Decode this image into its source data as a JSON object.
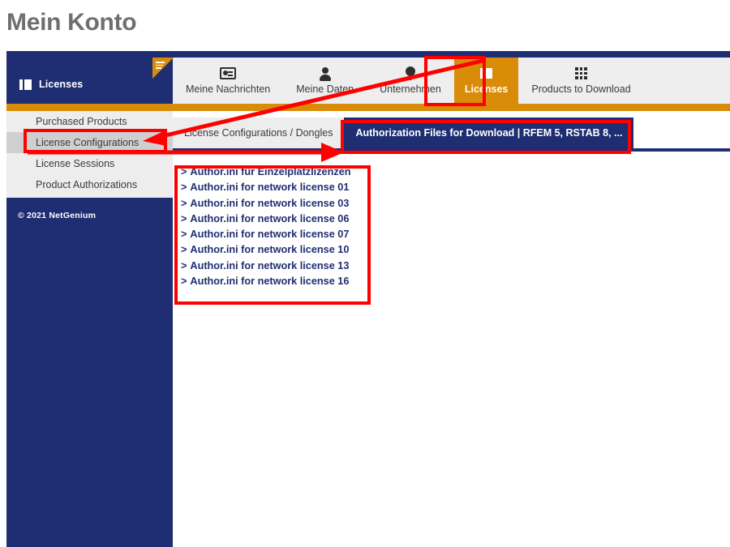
{
  "page": {
    "title": "Mein Konto"
  },
  "sidebar": {
    "header": {
      "label": "Licenses",
      "icon": "book-icon"
    },
    "items": [
      {
        "label": "Purchased Products",
        "selected": false
      },
      {
        "label": "License Configurations",
        "selected": true
      },
      {
        "label": "License Sessions",
        "selected": false
      },
      {
        "label": "Product Authorizations",
        "selected": false
      }
    ],
    "copyright": "© 2021 NetGenium"
  },
  "nav": {
    "tabs": [
      {
        "label": "Meine Nachrichten",
        "icon": "id-card-icon",
        "active": false
      },
      {
        "label": "Meine Daten",
        "icon": "person-icon",
        "active": false
      },
      {
        "label": "Unternehmen",
        "icon": "location-pin-icon",
        "active": false
      },
      {
        "label": "Licenses",
        "icon": "book-icon",
        "active": true
      },
      {
        "label": "Products to Download",
        "icon": "grid-icon",
        "active": false
      }
    ]
  },
  "content": {
    "tabs": [
      {
        "label": "License Configurations / Dongles",
        "active": false
      },
      {
        "label": "Authorization Files for Download | RFEM 5, RSTAB 8, ...",
        "active": true
      }
    ],
    "download_links": [
      "Author.ini für Einzelplatzlizenzen",
      "Author.ini for network license 01",
      "Author.ini for network license 03",
      "Author.ini for network license 06",
      "Author.ini for network license 07",
      "Author.ini for network license 10",
      "Author.ini for network license 13",
      "Author.ini for network license 16"
    ],
    "link_marker": ">"
  },
  "colors": {
    "brand_blue": "#1f2e72",
    "brand_orange": "#d98c08",
    "annotation_red": "#ff0000",
    "panel_grey": "#ededed",
    "title_grey": "#6f6f6f"
  }
}
